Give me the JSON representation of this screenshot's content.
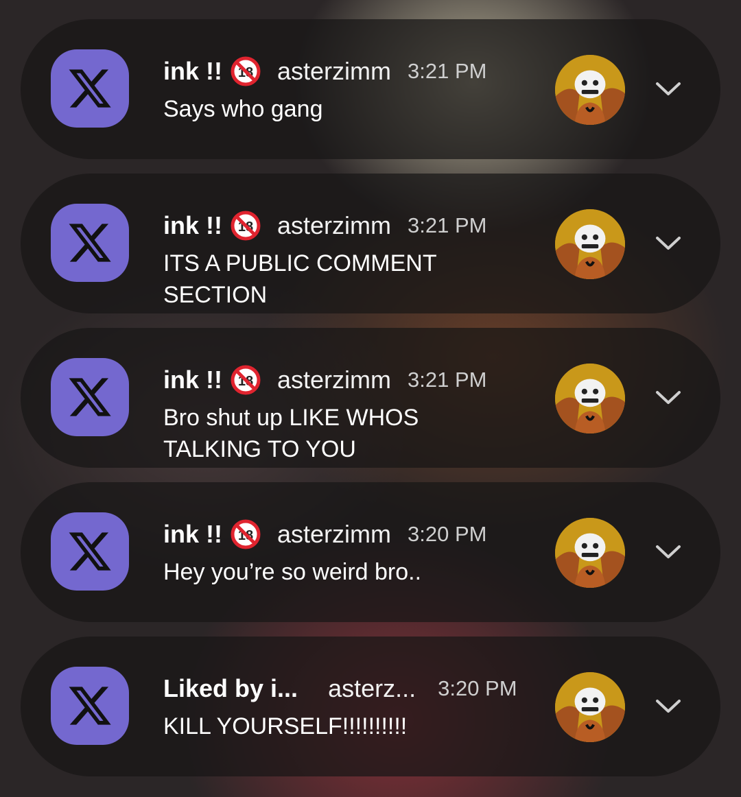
{
  "notifications": [
    {
      "app_icon": "x-logo-icon",
      "sender": "ink !!",
      "badge_icon": "no-under-18-icon",
      "account": "asterzimm",
      "time": "3:21 PM",
      "message": "Says who gang",
      "avatar_icon": "skeleton-avatar-icon",
      "expand_icon": "chevron-down-icon"
    },
    {
      "app_icon": "x-logo-icon",
      "sender": "ink !!",
      "badge_icon": "no-under-18-icon",
      "account": "asterzimm",
      "time": "3:21 PM",
      "message": "ITS A PUBLIC COMMENT SECTION",
      "avatar_icon": "skeleton-avatar-icon",
      "expand_icon": "chevron-down-icon"
    },
    {
      "app_icon": "x-logo-icon",
      "sender": "ink !!",
      "badge_icon": "no-under-18-icon",
      "account": "asterzimm",
      "time": "3:21 PM",
      "message": "Bro shut up LIKE WHOS TALKING TO YOU",
      "avatar_icon": "skeleton-avatar-icon",
      "expand_icon": "chevron-down-icon"
    },
    {
      "app_icon": "x-logo-icon",
      "sender": "ink !!",
      "badge_icon": "no-under-18-icon",
      "account": "asterzimm",
      "time": "3:20 PM",
      "message": "Hey you’re so weird bro..",
      "avatar_icon": "skeleton-avatar-icon",
      "expand_icon": "chevron-down-icon"
    },
    {
      "app_icon": "x-logo-icon",
      "sender": "Liked by i...",
      "account": "asterz...",
      "time": "3:20 PM",
      "message": "KILL YOURSELF!!!!!!!!!!",
      "avatar_icon": "skeleton-avatar-icon",
      "expand_icon": "chevron-down-icon"
    }
  ],
  "colors": {
    "app_icon_bg": "#7468cf",
    "card_bg": "#181616",
    "badge_red": "#e0242f"
  }
}
